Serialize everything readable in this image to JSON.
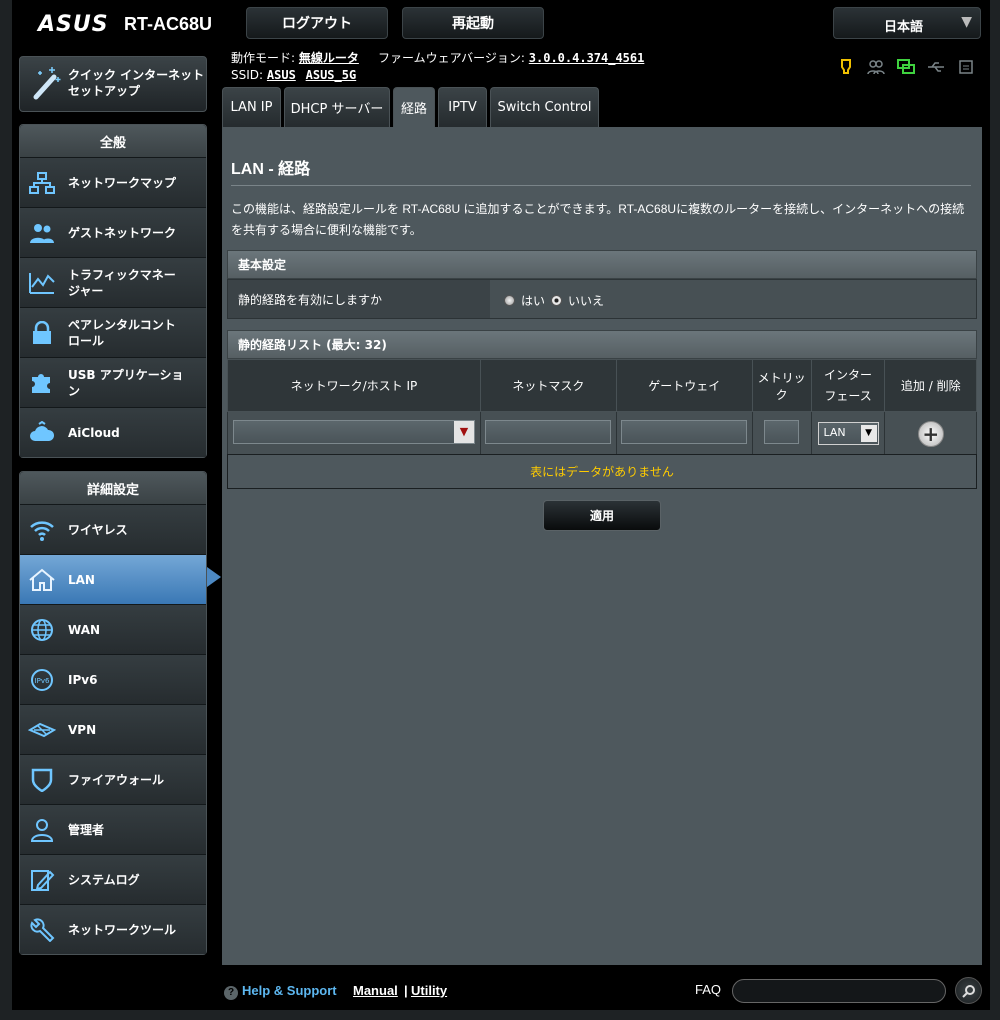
{
  "header": {
    "brand": "ASUS",
    "model": "RT-AC68U",
    "logout_label": "ログアウト",
    "reboot_label": "再起動",
    "language": "日本語"
  },
  "info": {
    "mode_label": "動作モード:",
    "mode_value": "無線ルータ",
    "firmware_label": "ファームウェアバージョン:",
    "firmware_value": "3.0.0.4.374_4561",
    "ssid_label": "SSID:",
    "ssid_1": "ASUS",
    "ssid_2": "ASUS_5G"
  },
  "status_icons": [
    "usb-light-icon",
    "clients-icon",
    "network-icon",
    "usb-icon",
    "printer-icon"
  ],
  "sidebar": {
    "quick_setup": "クイック インターネット\nセットアップ",
    "general_header": "全般",
    "general_items": [
      {
        "label": "ネットワークマップ",
        "icon": "network-map-icon"
      },
      {
        "label": "ゲストネットワーク",
        "icon": "guest-network-icon"
      },
      {
        "label": "トラフィックマネー\nジャー",
        "icon": "traffic-manager-icon"
      },
      {
        "label": "ペアレンタルコント\nロール",
        "icon": "parental-control-icon"
      },
      {
        "label": "USB アプリケーショ\nン",
        "icon": "usb-app-icon"
      },
      {
        "label": "AiCloud",
        "icon": "aicloud-icon"
      }
    ],
    "advanced_header": "詳細設定",
    "advanced_items": [
      {
        "label": "ワイヤレス",
        "icon": "wireless-icon"
      },
      {
        "label": "LAN",
        "icon": "lan-icon"
      },
      {
        "label": "WAN",
        "icon": "wan-icon"
      },
      {
        "label": "IPv6",
        "icon": "ipv6-icon"
      },
      {
        "label": "VPN",
        "icon": "vpn-icon"
      },
      {
        "label": "ファイアウォール",
        "icon": "firewall-icon"
      },
      {
        "label": "管理者",
        "icon": "administration-icon"
      },
      {
        "label": "システムログ",
        "icon": "system-log-icon"
      },
      {
        "label": "ネットワークツール",
        "icon": "network-tools-icon"
      }
    ]
  },
  "tabs": [
    "LAN IP",
    "DHCP サーバー",
    "経路",
    "IPTV",
    "Switch Control"
  ],
  "main": {
    "title": "LAN - 経路",
    "description": "この機能は、経路設定ルールを RT-AC68U に追加することができます。RT-AC68Uに複数のルーターを接続し、インターネットへの接続を共有する場合に便利な機能です。",
    "basic_header": "基本設定",
    "static_route_question": "静的経路を有効にしますか",
    "yes_label": "はい",
    "no_label": "いいえ",
    "list_header": "静的経路リスト (最大: 32)",
    "columns": [
      "ネットワーク/ホスト IP",
      "ネットマスク",
      "ゲートウェイ",
      "メトリック",
      "インター\nフェース",
      "追加 / 削除"
    ],
    "interface_value": "LAN",
    "empty_text": "表にはデータがありません",
    "apply_label": "適用"
  },
  "footer": {
    "help": "Help & Support",
    "manual": "Manual",
    "separator": "|",
    "utility": "Utility",
    "faq": "FAQ"
  }
}
